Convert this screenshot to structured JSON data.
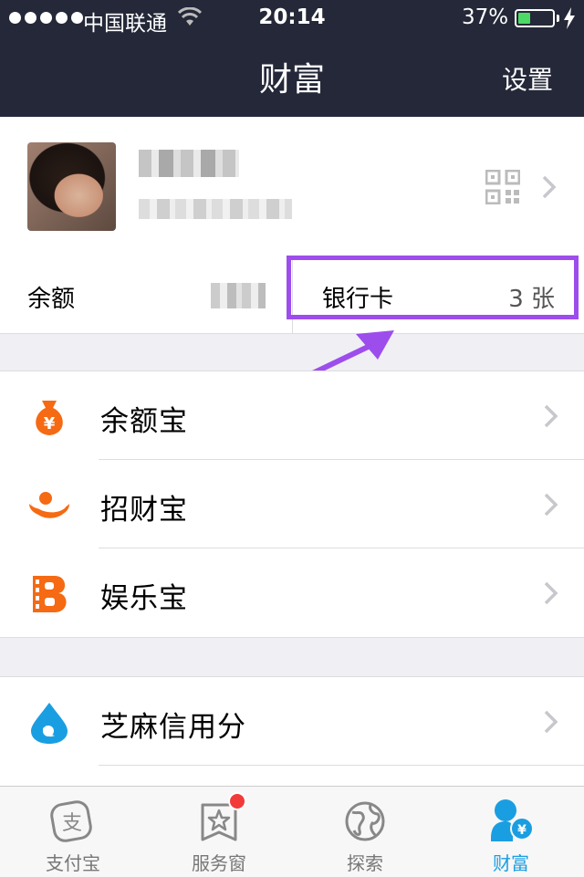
{
  "status_bar": {
    "carrier": "中国联通",
    "time": "20:14",
    "battery_percent": "37%",
    "battery_level": 0.37
  },
  "nav": {
    "title": "财富",
    "settings_label": "设置"
  },
  "profile": {
    "avatar": "avatar",
    "qr_icon": "qr-code-icon"
  },
  "balance_row": {
    "balance_label": "余额",
    "bank_card_label": "银行卡",
    "bank_card_count": "3 张"
  },
  "wealth_items": [
    {
      "label": "余额宝",
      "icon": "money-bag-icon",
      "color": "#f56a12"
    },
    {
      "label": "招财宝",
      "icon": "fortune-icon",
      "color": "#f56a12"
    },
    {
      "label": "娱乐宝",
      "icon": "film-b-icon",
      "color": "#f56a12"
    }
  ],
  "credit_items": [
    {
      "label": "芝麻信用分",
      "icon": "drop-icon",
      "color": "#1a9ee2"
    }
  ],
  "tabbar": {
    "tabs": [
      {
        "label": "支付宝",
        "icon": "alipay-icon",
        "active": false
      },
      {
        "label": "服务窗",
        "icon": "service-window-icon",
        "active": false,
        "badge": true
      },
      {
        "label": "探索",
        "icon": "globe-icon",
        "active": false
      },
      {
        "label": "财富",
        "icon": "wealth-icon",
        "active": true
      }
    ]
  },
  "colors": {
    "nav_bg": "#242838",
    "highlight": "#9d4dec",
    "accent": "#1a9ee2",
    "orange": "#f56a12"
  }
}
